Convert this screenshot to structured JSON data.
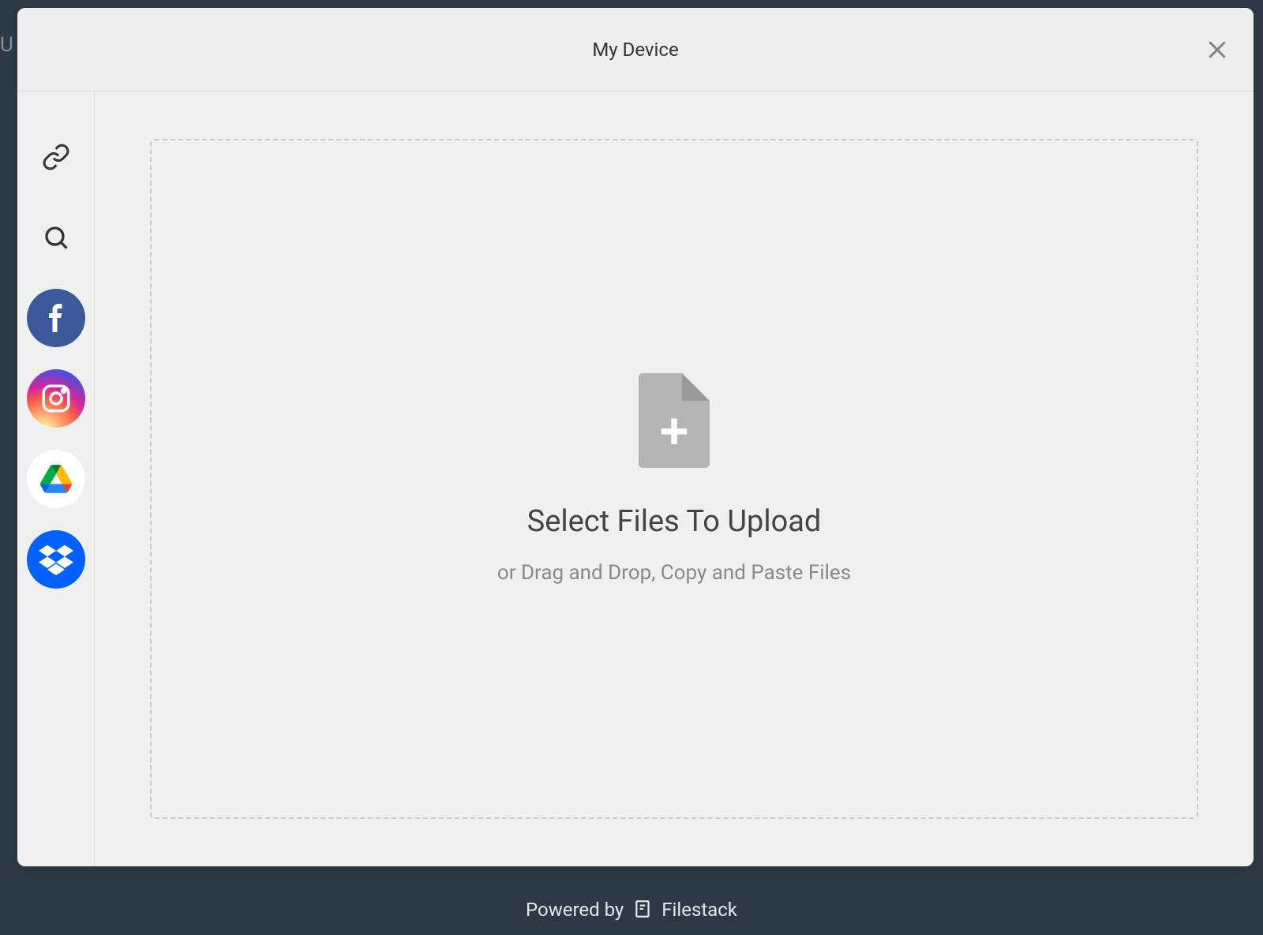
{
  "header": {
    "title": "My Device"
  },
  "sidebar": {
    "items": [
      {
        "name": "device",
        "label": "My Device"
      },
      {
        "name": "link",
        "label": "Link (URL)"
      },
      {
        "name": "search",
        "label": "Web Search"
      },
      {
        "name": "facebook",
        "label": "Facebook"
      },
      {
        "name": "instagram",
        "label": "Instagram"
      },
      {
        "name": "gdrive",
        "label": "Google Drive"
      },
      {
        "name": "dropbox",
        "label": "Dropbox"
      }
    ]
  },
  "dropzone": {
    "title": "Select Files To Upload",
    "subtitle": "or Drag and Drop, Copy and Paste Files"
  },
  "footer": {
    "prefix": "Powered by",
    "brand": "Filestack"
  }
}
